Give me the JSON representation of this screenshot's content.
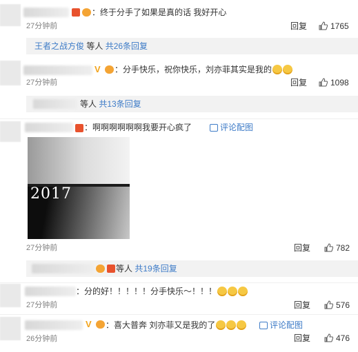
{
  "comments": [
    {
      "text": "：终于分手了如果是真的话 我好开心",
      "time": "27分钟前",
      "reply": "回复",
      "likes": "1765"
    },
    {
      "text": "：分手快乐，祝你快乐，刘亦菲其实是我的",
      "time": "27分钟前",
      "reply": "回复",
      "likes": "1098"
    },
    {
      "text": "：啊啊啊啊啊啊我要开心疯了",
      "time": "27分钟前",
      "reply": "回复",
      "likes": "782",
      "pic_link": "评论配图",
      "image_text": "2017"
    },
    {
      "text": "：分的好！！！！！分手快乐～！！！",
      "time": "27分钟前",
      "reply": "回复",
      "likes": "576"
    },
    {
      "text": "：喜大普奔 刘亦菲又是我的了",
      "time": "26分钟前",
      "reply": "回复",
      "likes": "476",
      "pic_link": "评论配图"
    }
  ],
  "subreplies": [
    {
      "name": "王者之战方俊",
      "middle": " 等人 ",
      "count": "共26条回复"
    },
    {
      "middle": "等人 ",
      "count": "共13条回复"
    },
    {
      "middle": " 等人 ",
      "count": "共19条回复"
    }
  ],
  "colors": {
    "link": "#3d7bc7",
    "badge": "#e8522d",
    "v_badge": "#f2a41c"
  }
}
